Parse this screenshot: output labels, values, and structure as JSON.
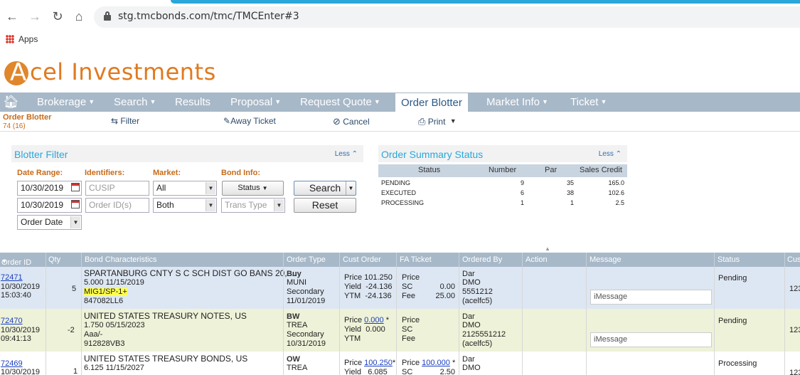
{
  "browser": {
    "url": "stg.tmcbonds.com/tmc/TMCEnter#3",
    "bookmarks_apps": "Apps"
  },
  "logo": {
    "initial": "A",
    "name_rest": "cel Investments"
  },
  "nav": {
    "items": [
      {
        "label": "Brokerage",
        "dropdown": true
      },
      {
        "label": "Search",
        "dropdown": true
      },
      {
        "label": "Results",
        "dropdown": false
      },
      {
        "label": "Proposal",
        "dropdown": true
      },
      {
        "label": "Request Quote",
        "dropdown": true
      },
      {
        "label": "Order Blotter",
        "dropdown": false,
        "active": true
      },
      {
        "label": "Market Info",
        "dropdown": true
      },
      {
        "label": "Ticket",
        "dropdown": true
      }
    ]
  },
  "toolbar": {
    "title": "Order Blotter",
    "count": "74 (16)",
    "filter": "Filter",
    "away_ticket": "Away Ticket",
    "cancel": "Cancel",
    "print": "Print"
  },
  "filter_panel": {
    "title": "Blotter Filter",
    "less": "Less",
    "labels": {
      "date_range": "Date Range:",
      "identifiers": "Identifiers:",
      "market": "Market:",
      "bond_info": "Bond Info:"
    },
    "date_from": "10/30/2019",
    "date_to": "10/30/2019",
    "cusip_placeholder": "CUSIP",
    "order_id_placeholder": "Order ID(s)",
    "market_select_1": "All",
    "market_select_2": "Both",
    "status_select": "Status",
    "trans_type_select": "Trans Type",
    "date_type_select": "Order Date",
    "search_button": "Search",
    "reset_button": "Reset"
  },
  "summary": {
    "title": "Order Summary Status",
    "less": "Less",
    "headers": [
      "Status",
      "Number",
      "Par",
      "Sales Credit"
    ],
    "rows": [
      {
        "status": "PENDING",
        "number": "9",
        "par": "35",
        "credit": "165.0"
      },
      {
        "status": "EXECUTED",
        "number": "6",
        "par": "38",
        "credit": "102.6"
      },
      {
        "status": "PROCESSING",
        "number": "1",
        "par": "1",
        "credit": "2.5"
      }
    ]
  },
  "grid": {
    "headers": {
      "order_id": "Order ID",
      "qty": "Qty",
      "bond": "Bond Characteristics",
      "order_type": "Order Type",
      "cust_order": "Cust Order",
      "fa_ticket": "FA Ticket",
      "ordered_by": "Ordered By",
      "action": "Action",
      "message": "Message",
      "status": "Status",
      "cust": "Cus"
    },
    "rows": [
      {
        "order_id": "72471",
        "date": "10/30/2019",
        "time": "15:03:40",
        "qty": "5",
        "bond_name": "SPARTANBURG CNTY S C SCH DIST GO BANS 20, ...",
        "coupon_maturity": "5.000  11/15/2019",
        "rating": "MIG1/SP-1+",
        "cusip": "847082LL6",
        "type": "Buy",
        "type2": "MUNI",
        "type3": "Secondary",
        "type_date": "11/01/2019",
        "price_label": "Price",
        "price": "101.250",
        "price_star": "",
        "yield_label": "Yield",
        "yield": "-24.136",
        "ytm_label": "YTM",
        "ytm": "-24.136",
        "fa_price_label": "Price",
        "fa_price": "",
        "fa_price_star": "",
        "sc_label": "SC",
        "sc": "0.00",
        "fee_label": "Fee",
        "fee": "25.00",
        "ob1": "Dar",
        "ob2": "DMO",
        "ob3": "5551212",
        "ob4": "(acelfc5)",
        "message_placeholder": "iMessage",
        "status": "Pending",
        "cust": "123"
      },
      {
        "order_id": "72470",
        "date": "10/30/2019",
        "time": "09:41:13",
        "qty": "-2",
        "bond_name": "UNITED STATES TREASURY NOTES, US",
        "coupon_maturity": "1.750  05/15/2023",
        "rating": "Aaa/-",
        "cusip": "912828VB3",
        "type": "BW",
        "type2": "TREA",
        "type3": "Secondary",
        "type_date": "10/31/2019",
        "price_label": "Price",
        "price": "0.000",
        "price_star": "*",
        "yield_label": "Yield",
        "yield": "0.000",
        "ytm_label": "YTM",
        "ytm": "",
        "fa_price_label": "Price",
        "fa_price": "",
        "fa_price_star": "",
        "sc_label": "SC",
        "sc": "",
        "fee_label": "Fee",
        "fee": "",
        "ob1": "Dar",
        "ob2": "DMO",
        "ob3": "2125551212",
        "ob4": "(acelfc5)",
        "message_placeholder": "iMessage",
        "status": "Pending",
        "cust": "123"
      },
      {
        "order_id": "72469",
        "date": "10/30/2019",
        "qty": "1",
        "bond_name": "UNITED STATES TREASURY BONDS, US",
        "coupon_maturity": "6.125  11/15/2027",
        "type": "OW",
        "type2": "TREA",
        "price_label": "Price",
        "price": "100.250",
        "price_star": "*",
        "yield_label": "Yield",
        "yield": "6.085",
        "fa_price_label": "Price",
        "fa_price": "100.000",
        "fa_price_star": "*",
        "sc_label": "SC",
        "sc": "2.50",
        "ob1": "Dar",
        "ob2": "DMO",
        "status": "Processing",
        "cust": "123"
      }
    ]
  }
}
